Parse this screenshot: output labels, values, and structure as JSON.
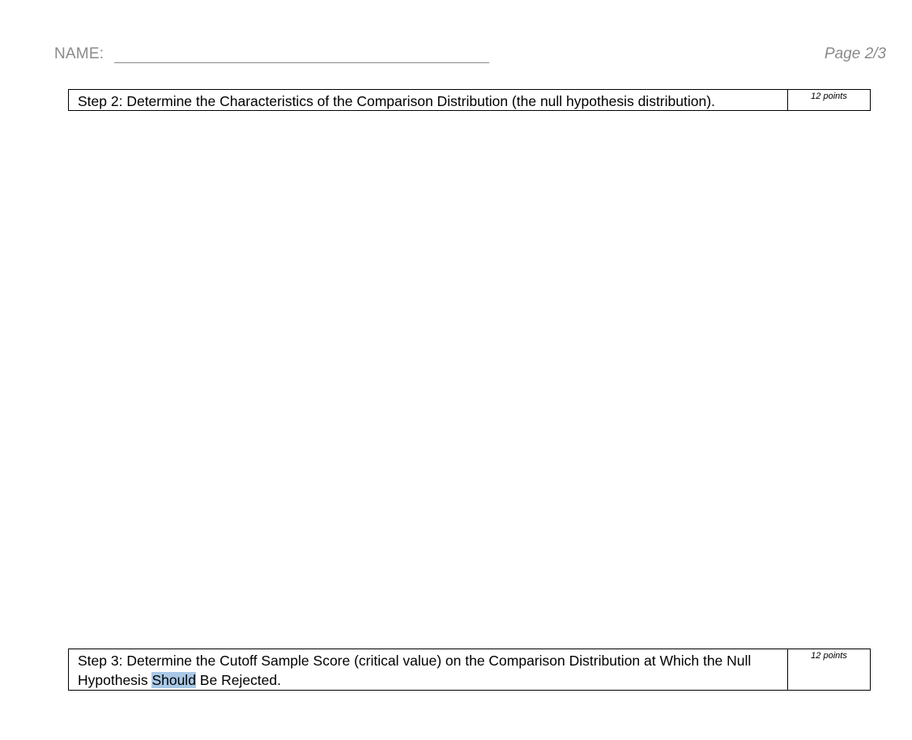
{
  "header": {
    "name_label": "NAME:",
    "page_label": "Page 2/3"
  },
  "steps": [
    {
      "text": "Step 2: Determine the Characteristics of the Comparison Distribution (the null hypothesis distribution).",
      "points": "12 points"
    },
    {
      "text_before": "Step 3: Determine the Cutoff Sample Score (critical value) on the Comparison Distribution at Which the Null Hypothesis ",
      "text_highlight": "Should",
      "text_after": " Be Rejected.",
      "points": "12 points"
    }
  ],
  "colors": {
    "header_text": "#8a8a8a",
    "selection_highlight": "#a9c8e6"
  }
}
